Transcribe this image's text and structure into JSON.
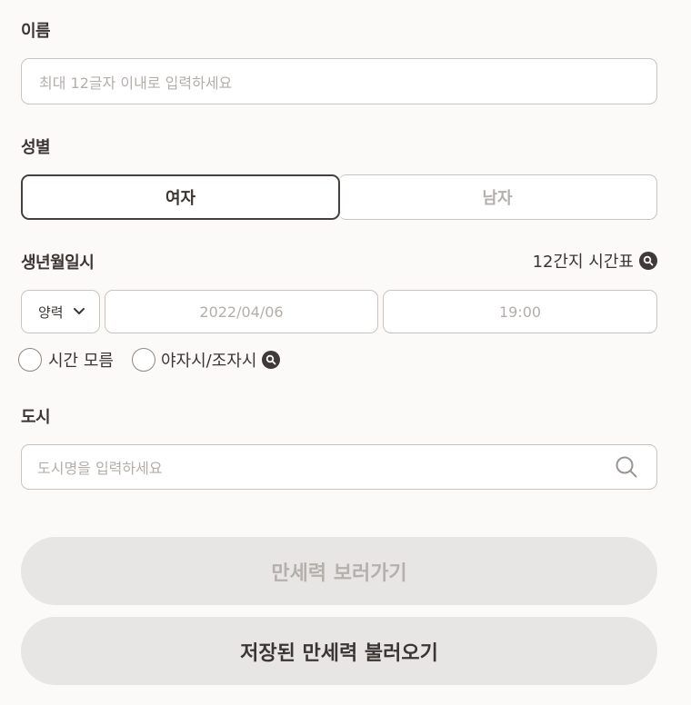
{
  "name_section": {
    "label": "이름",
    "placeholder": "최대 12글자 이내로 입력하세요"
  },
  "gender_section": {
    "label": "성별",
    "options": [
      "여자",
      "남자"
    ],
    "selected": "여자"
  },
  "birth_section": {
    "label": "생년월일시",
    "table_link": "12간지 시간표",
    "calendar_type": "양력",
    "date_placeholder": "2022/04/06",
    "time_placeholder": "19:00",
    "unknown_time_label": "시간 모름",
    "night_time_label": "야자시/조자시"
  },
  "city_section": {
    "label": "도시",
    "placeholder": "도시명을 입력하세요"
  },
  "buttons": {
    "view_label": "만세력 보러가기",
    "load_label": "저장된 만세력 불러오기"
  },
  "colors": {
    "background": "#fcfaf8",
    "text_dark": "#3b3633",
    "text_muted": "#b5b0ac",
    "border": "#c9c4bf",
    "button_bg": "#e8e6e4"
  },
  "icons": [
    "search-icon",
    "magnifier-badge-icon",
    "chevron-down-icon"
  ]
}
